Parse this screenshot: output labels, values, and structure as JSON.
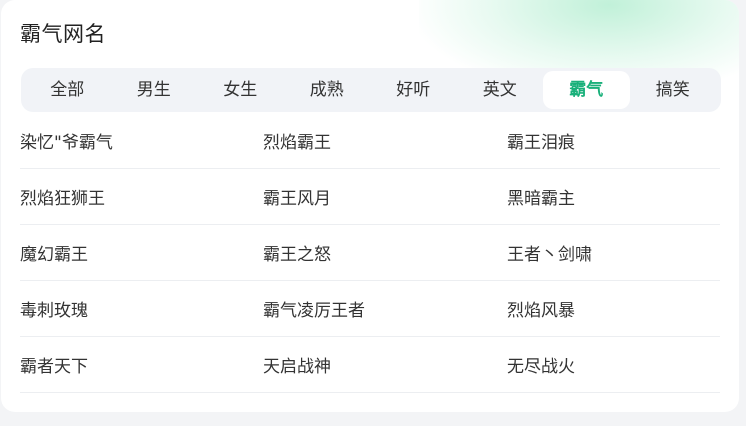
{
  "title": "霸气网名",
  "tabs": [
    "全部",
    "男生",
    "女生",
    "成熟",
    "好听",
    "英文",
    "霸气",
    "搞笑"
  ],
  "active_tab": "霸气",
  "accent_color": "#19b07a",
  "names": [
    [
      "染忆\"爷霸气",
      "烈焰霸王",
      "霸王泪痕"
    ],
    [
      "烈焰狂狮王",
      "霸王风月",
      "黑暗霸主"
    ],
    [
      "魔幻霸王",
      "霸王之怒",
      "王者丶剑啸"
    ],
    [
      "毒刺玫瑰",
      "霸气凌厉王者",
      "烈焰风暴"
    ],
    [
      "霸者天下",
      "天启战神",
      "无尽战火"
    ]
  ]
}
